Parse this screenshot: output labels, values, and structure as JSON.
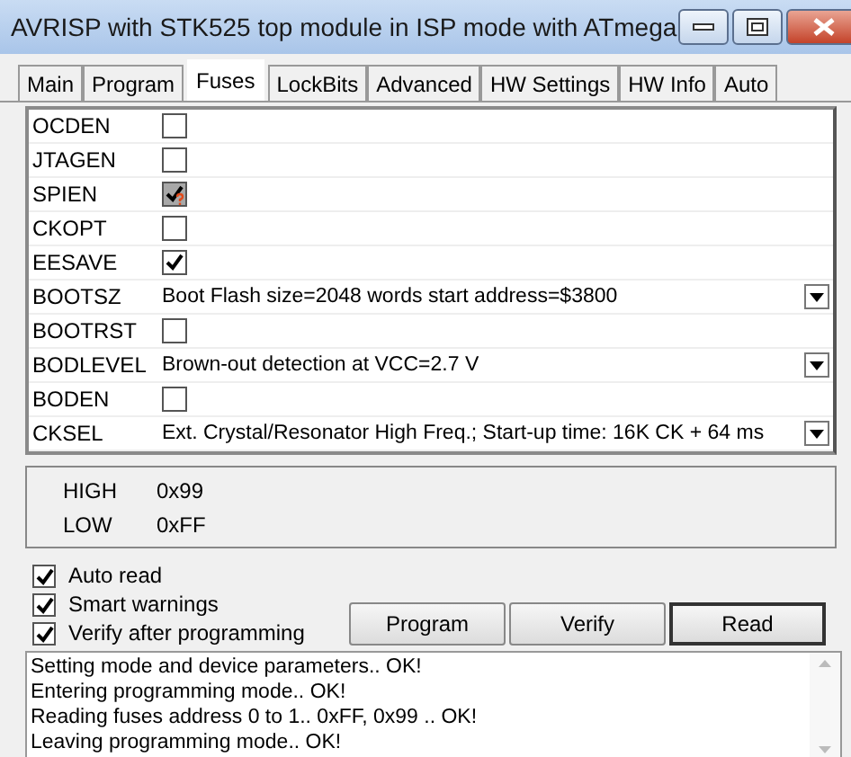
{
  "window": {
    "title": "AVRISP with STK525 top module in ISP mode with ATmega"
  },
  "tabs": [
    {
      "label": "Main",
      "selected": false
    },
    {
      "label": "Program",
      "selected": false
    },
    {
      "label": "Fuses",
      "selected": true
    },
    {
      "label": "LockBits",
      "selected": false
    },
    {
      "label": "Advanced",
      "selected": false
    },
    {
      "label": "HW Settings",
      "selected": false
    },
    {
      "label": "HW Info",
      "selected": false
    },
    {
      "label": "Auto",
      "selected": false
    }
  ],
  "fuses": [
    {
      "name": "OCDEN",
      "kind": "checkbox",
      "checked": false,
      "disabled": false
    },
    {
      "name": "JTAGEN",
      "kind": "checkbox",
      "checked": false,
      "disabled": false
    },
    {
      "name": "SPIEN",
      "kind": "checkbox",
      "checked": true,
      "disabled": true
    },
    {
      "name": "CKOPT",
      "kind": "checkbox",
      "checked": false,
      "disabled": false
    },
    {
      "name": "EESAVE",
      "kind": "checkbox",
      "checked": true,
      "disabled": false
    },
    {
      "name": "BOOTSZ",
      "kind": "dropdown",
      "value": "Boot Flash size=2048 words start address=$3800"
    },
    {
      "name": "BOOTRST",
      "kind": "checkbox",
      "checked": false,
      "disabled": false
    },
    {
      "name": "BODLEVEL",
      "kind": "dropdown",
      "value": "Brown-out detection at VCC=2.7 V"
    },
    {
      "name": "BODEN",
      "kind": "checkbox",
      "checked": false,
      "disabled": false
    },
    {
      "name": "CKSEL",
      "kind": "dropdown",
      "value": "Ext. Crystal/Resonator High Freq.; Start-up time: 16K CK + 64 ms"
    }
  ],
  "fuse_values": [
    {
      "name": "HIGH",
      "value": "0x99"
    },
    {
      "name": "LOW",
      "value": "0xFF"
    }
  ],
  "options": [
    {
      "label": "Auto read",
      "checked": true
    },
    {
      "label": "Smart warnings",
      "checked": true
    },
    {
      "label": "Verify after programming",
      "checked": true
    }
  ],
  "buttons": [
    {
      "label": "Program",
      "default": false
    },
    {
      "label": "Verify",
      "default": false
    },
    {
      "label": "Read",
      "default": true
    }
  ],
  "log": [
    "Setting mode and device parameters.. OK!",
    "Entering programming mode.. OK!",
    "Reading fuses address 0 to 1.. 0xFF, 0x99 .. OK!",
    "Leaving programming mode.. OK!"
  ]
}
